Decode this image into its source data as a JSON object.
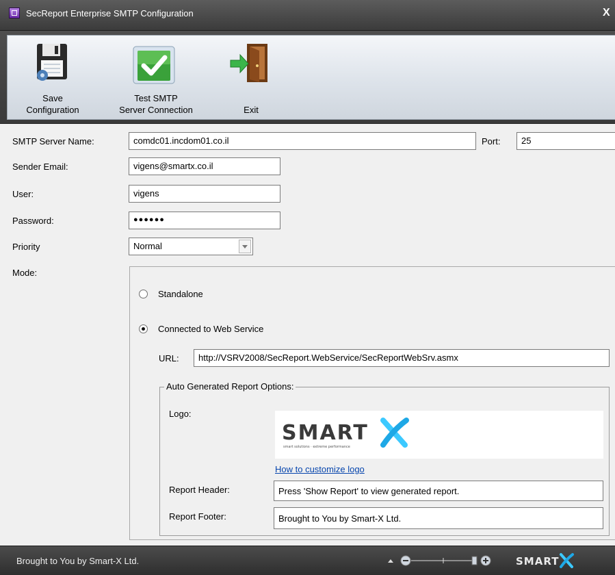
{
  "window": {
    "title": "SecReport Enterprise SMTP Configuration",
    "close_label": "X"
  },
  "toolbar": {
    "save": {
      "line1": "Save",
      "line2": "Configuration",
      "icon": "floppy-disk-icon"
    },
    "test": {
      "line1": "Test SMTP",
      "line2": "Server Connection",
      "icon": "checkmark-icon"
    },
    "exit": {
      "label": "Exit",
      "icon": "exit-door-icon"
    }
  },
  "form": {
    "smtp_server_label": "SMTP Server Name:",
    "smtp_server_value": "comdc01.incdom01.co.il",
    "port_label": "Port:",
    "port_value": "25",
    "sender_email_label": "Sender Email:",
    "sender_email_value": "vigens@smartx.co.il",
    "user_label": "User:",
    "user_value": "vigens",
    "password_label": "Password:",
    "password_value": "●●●●●●",
    "priority_label": "Priority",
    "priority_value": "Normal",
    "mode_label": "Mode:"
  },
  "mode": {
    "standalone_label": "Standalone",
    "standalone_selected": false,
    "web_service_label": "Connected to Web Service",
    "web_service_selected": true,
    "url_label": "URL:",
    "url_value": "http://VSRV2008/SecReport.WebService/SecReportWebSrv.asmx"
  },
  "report_options": {
    "group_title": "Auto Generated Report Options:",
    "logo_label": "Logo:",
    "logo_text": "SMARTX",
    "logo_tagline": "smart solutions · extreme performance",
    "customize_link": "How to customize logo",
    "header_label": "Report Header:",
    "header_value": "Press 'Show Report' to view generated report.",
    "footer_label": "Report Footer:",
    "footer_value": "Brought to You by Smart-X Ltd."
  },
  "status": {
    "text": "Brought to You by Smart-X Ltd.",
    "brand": "SMARTX"
  },
  "colors": {
    "accent": "#3cc9ff",
    "link": "#0645ad",
    "check_green": "#3aa13a"
  }
}
